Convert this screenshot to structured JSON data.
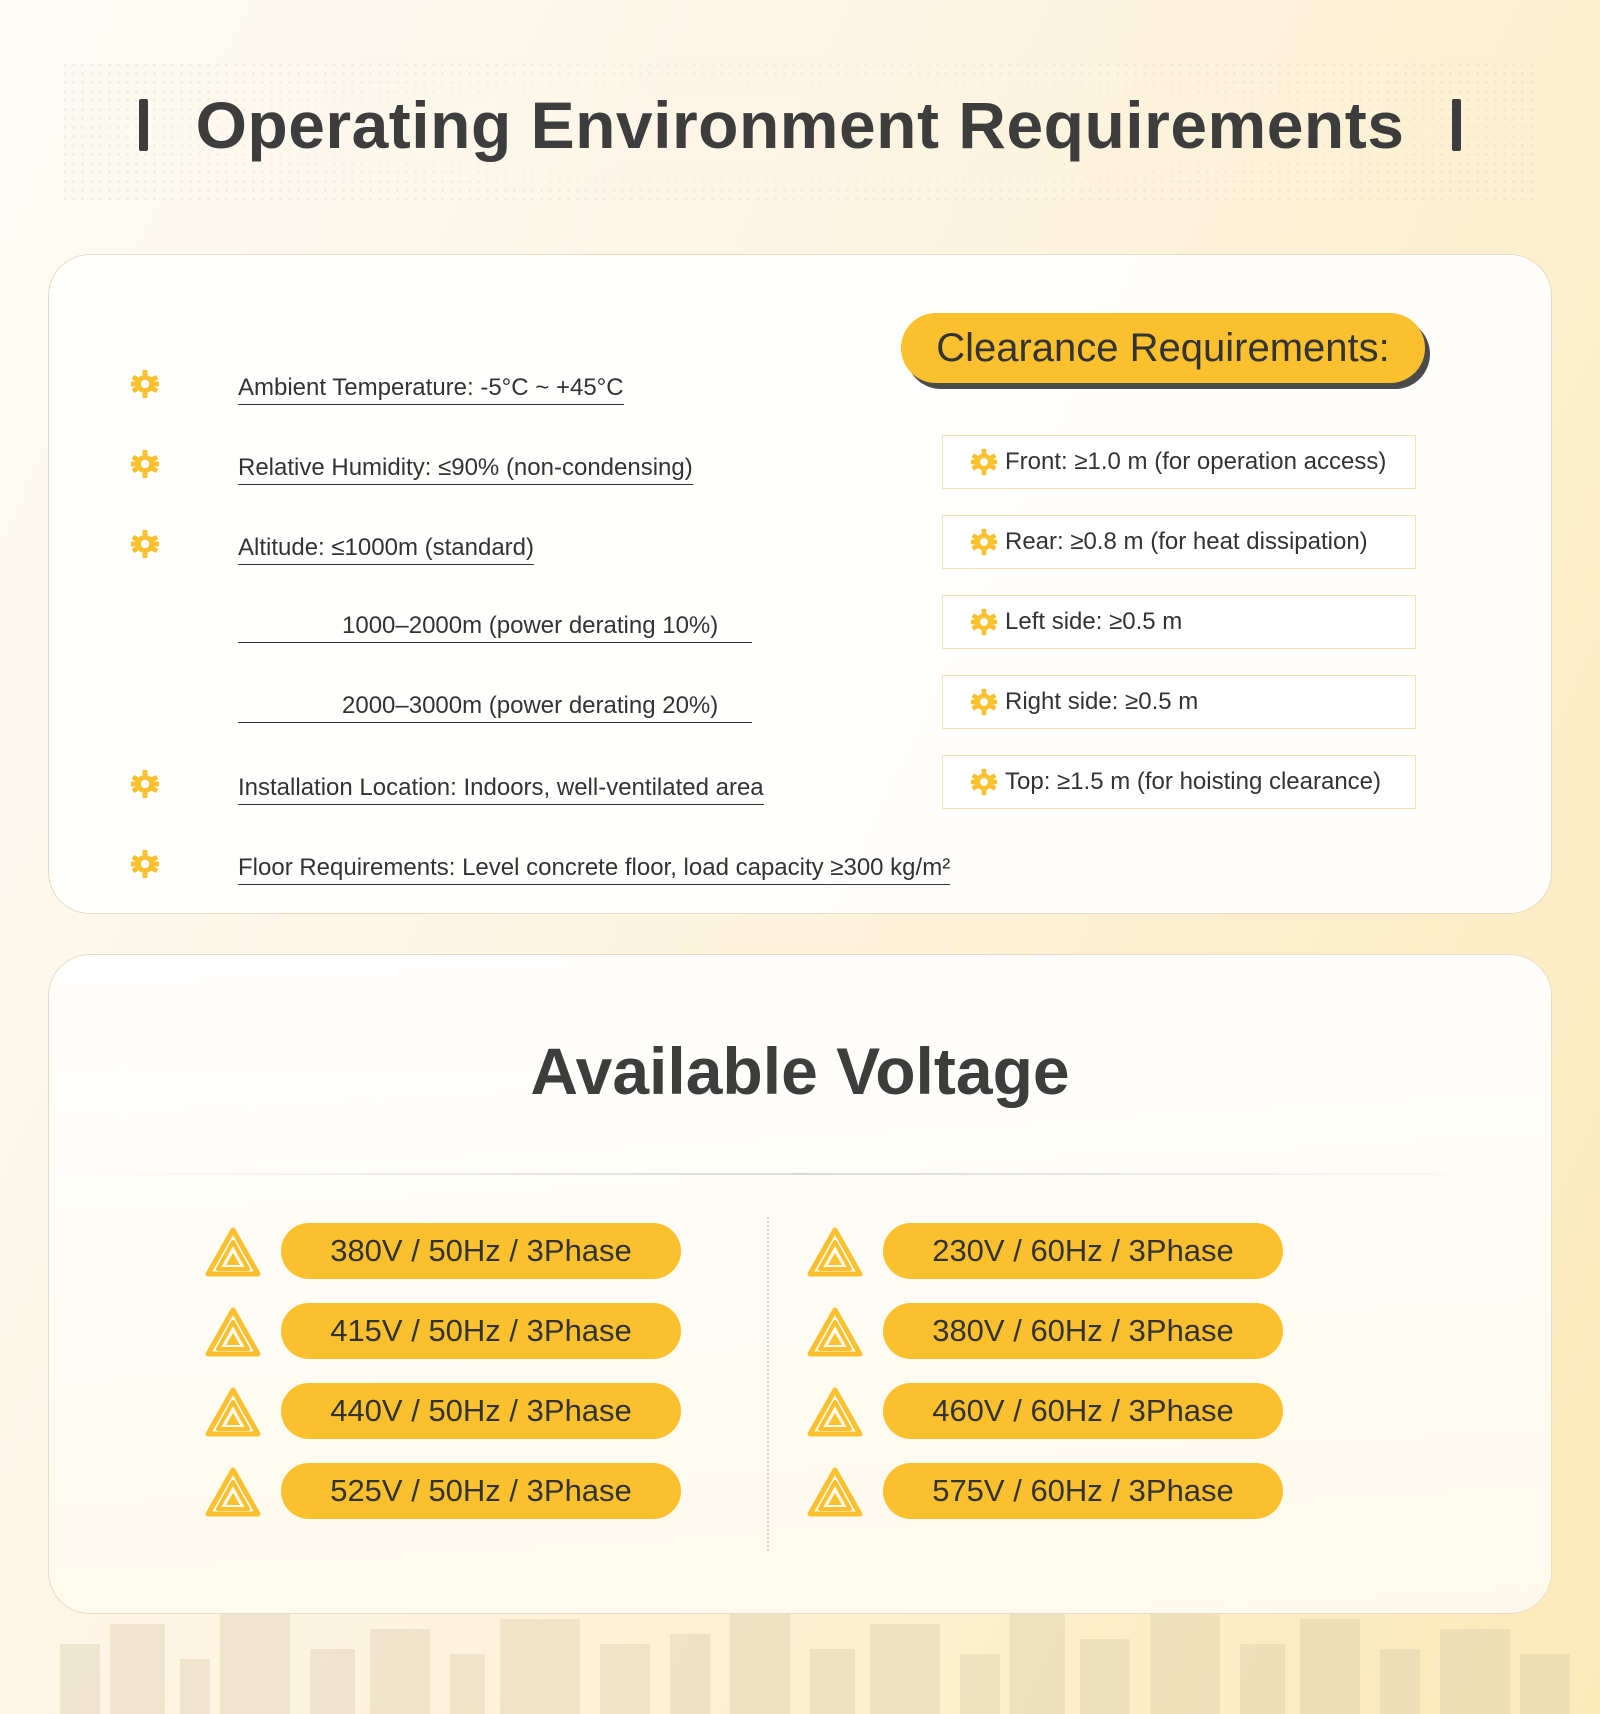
{
  "page": {
    "title": "Operating Environment Requirements"
  },
  "environment": {
    "items": [
      "Ambient Temperature: -5°C ~ +45°C",
      "Relative Humidity: ≤90% (non-condensing)",
      "Altitude: ≤1000m (standard)",
      "Installation Location: Indoors, well-ventilated area",
      "Floor Requirements: Level concrete floor, load capacity ≥300 kg/m²"
    ],
    "altitude_sub": [
      "1000–2000m (power derating 10%)",
      "2000–3000m (power derating 20%)"
    ]
  },
  "clearance": {
    "title": "Clearance Requirements:",
    "items": [
      "Front: ≥1.0 m (for operation access)",
      "Rear: ≥0.8 m (for heat dissipation)",
      "Left side: ≥0.5 m",
      "Right side: ≥0.5 m",
      "Top: ≥1.5 m (for hoisting clearance)"
    ]
  },
  "voltage": {
    "title": "Available Voltage",
    "left": [
      "380V / 50Hz / 3Phase",
      "415V / 50Hz / 3Phase",
      "440V / 50Hz / 3Phase",
      "525V / 50Hz / 3Phase"
    ],
    "right": [
      "230V / 60Hz / 3Phase",
      "380V / 60Hz / 3Phase",
      "460V / 60Hz / 3Phase",
      "575V / 60Hz / 3Phase"
    ]
  },
  "colors": {
    "accent": "#fbc02d",
    "text": "#3d3d3d",
    "background": "#fdf4e0"
  },
  "icons": {
    "bullet": "gear-icon",
    "voltage": "triangle-logo-icon",
    "title_marks": "vertical-bar"
  }
}
